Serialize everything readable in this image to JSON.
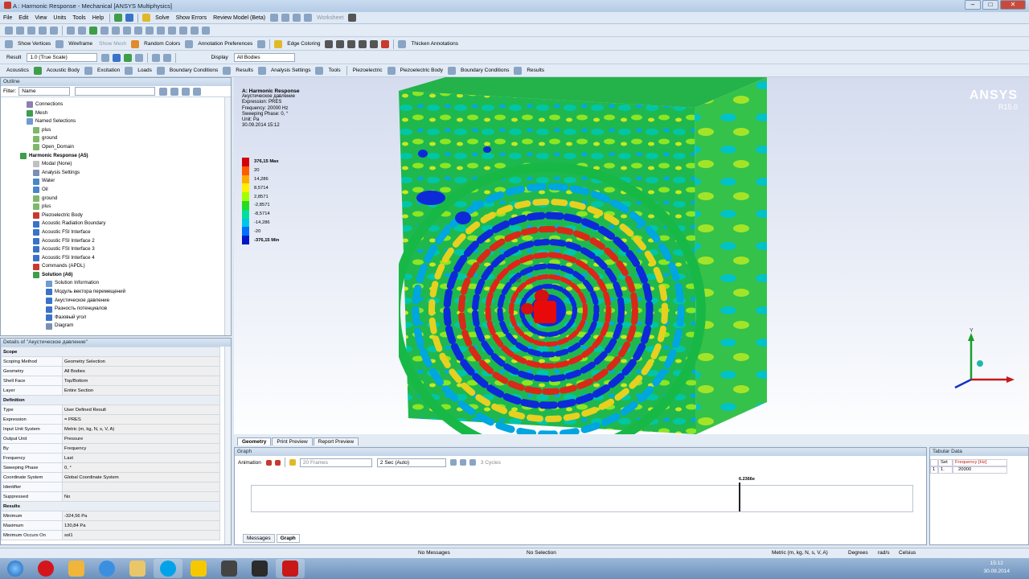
{
  "window": {
    "title": "A : Harmonic Response - Mechanical [ANSYS Multiphysics]"
  },
  "menu": {
    "items": [
      "File",
      "Edit",
      "View",
      "Units",
      "Tools",
      "Help"
    ],
    "solve": "Solve",
    "show_errors": "Show Errors",
    "review_model": "Review Model (Beta)",
    "worksheet": "Worksheet"
  },
  "toolbar2": {
    "show_vertices": "Show Vertices",
    "wireframe": "Wireframe",
    "show_mesh": "Show Mesh",
    "random_colors": "Random Colors",
    "annotation_prefs": "Annotation Preferences",
    "edge_coloring": "Edge Coloring",
    "thicken": "Thicken Annotations"
  },
  "toolbar3": {
    "result_label": "Result",
    "scale": "1.0 (True Scale)",
    "display_label": "Display",
    "display_value": "All Bodies"
  },
  "toolbar4": {
    "items": [
      "Acoustics",
      "Acoustic Body",
      "Excitation",
      "Loads",
      "Boundary Conditions",
      "Results",
      "Analysis Settings",
      "Tools",
      "Piezoelectric",
      "Piezoelectric Body",
      "Boundary Conditions",
      "Results"
    ]
  },
  "outline": {
    "title": "Outline",
    "filter_label": "Filter:",
    "filter_value": "Name",
    "items": [
      {
        "label": "Connections",
        "color": "#8a7fb3"
      },
      {
        "label": "Mesh",
        "color": "#3f9d4c"
      },
      {
        "label": "Named Selections",
        "color": "#6e9bd1"
      },
      {
        "label": "plus",
        "color": "#7fb86b"
      },
      {
        "label": "ground",
        "color": "#7fb86b"
      },
      {
        "label": "Open_Domain",
        "color": "#7fb86b"
      },
      {
        "label": "Harmonic Response (A5)",
        "color": "#3f9d4c"
      },
      {
        "label": "Modal (None)",
        "color": "#c0c0c0"
      },
      {
        "label": "Analysis Settings",
        "color": "#7a8fb3"
      },
      {
        "label": "Water",
        "color": "#4a86c8"
      },
      {
        "label": "Oil",
        "color": "#4a86c8"
      },
      {
        "label": "ground",
        "color": "#7fb86b"
      },
      {
        "label": "plus",
        "color": "#7fb86b"
      },
      {
        "label": "Piezoelectric Body",
        "color": "#c83a2e"
      },
      {
        "label": "Acoustic Radiation Boundary",
        "color": "#3a72c8"
      },
      {
        "label": "Acoustic FSI Interface",
        "color": "#3a72c8"
      },
      {
        "label": "Acoustic FSI Interface 2",
        "color": "#3a72c8"
      },
      {
        "label": "Acoustic FSI Interface 3",
        "color": "#3a72c8"
      },
      {
        "label": "Acoustic FSI Interface 4",
        "color": "#3a72c8"
      },
      {
        "label": "Commands (APDL)",
        "color": "#c83a2e"
      },
      {
        "label": "Solution (A6)",
        "color": "#3f9d4c"
      },
      {
        "label": "Solution Information",
        "color": "#6e9bd1"
      },
      {
        "label": "Модуль вектора перемещений",
        "color": "#3a72c8"
      },
      {
        "label": "Акустическое давление",
        "color": "#3a72c8"
      },
      {
        "label": "Разность потенциалов",
        "color": "#3a72c8"
      },
      {
        "label": "Фазовый угол",
        "color": "#3a72c8"
      },
      {
        "label": "Diagram",
        "color": "#7a8fb3"
      }
    ]
  },
  "details": {
    "title": "Details of \"Акустическое давление\"",
    "rows": [
      {
        "k": "Scope",
        "v": "",
        "sec": true
      },
      {
        "k": "Scoping Method",
        "v": "Geometry Selection"
      },
      {
        "k": "Geometry",
        "v": "All Bodies"
      },
      {
        "k": "Shell Face",
        "v": "Top/Bottom"
      },
      {
        "k": "Layer",
        "v": "Entire Section"
      },
      {
        "k": "Definition",
        "v": "",
        "sec": true
      },
      {
        "k": "Type",
        "v": "User Defined Result"
      },
      {
        "k": "Expression",
        "v": "= PRES"
      },
      {
        "k": "Input Unit System",
        "v": "Metric (m, kg, N, s, V, A)"
      },
      {
        "k": "Output Unit",
        "v": "Pressure"
      },
      {
        "k": "By",
        "v": "Frequency"
      },
      {
        "k": "Frequency",
        "v": "Last"
      },
      {
        "k": "Sweeping Phase",
        "v": "0, °"
      },
      {
        "k": "Coordinate System",
        "v": "Global Coordinate System"
      },
      {
        "k": "Identifier",
        "v": ""
      },
      {
        "k": "Suppressed",
        "v": "No"
      },
      {
        "k": "Results",
        "v": "",
        "sec": true
      },
      {
        "k": "Minimum",
        "v": "-324,56 Pa"
      },
      {
        "k": "Maximum",
        "v": "130,84 Pa"
      },
      {
        "k": "Minimum Occurs On",
        "v": "sol1"
      }
    ]
  },
  "viewport": {
    "header": [
      "A: Harmonic Response",
      "Акустическое давление",
      "Expression: PRES",
      "Frequency: 20000 Hz",
      "Sweeping Phase: 0, °",
      "Unit: Pa",
      "30.09.2014 15:12"
    ],
    "brand": "ANSYS",
    "version": "R15.0",
    "legend": [
      {
        "label": "376,15 Max",
        "color": "#d4000a",
        "bold": true
      },
      {
        "label": "20",
        "color": "#ff5a00"
      },
      {
        "label": "14,286",
        "color": "#ffaa00"
      },
      {
        "label": "8,5714",
        "color": "#fff000"
      },
      {
        "label": "2,8571",
        "color": "#a4ff00"
      },
      {
        "label": "-2,8571",
        "color": "#22dd22"
      },
      {
        "label": "-8,5714",
        "color": "#00e09a"
      },
      {
        "label": "-14,286",
        "color": "#00c6e6"
      },
      {
        "label": "-20",
        "color": "#0070ff"
      },
      {
        "label": "-376,15 Min",
        "color": "#0016c8",
        "bold": true
      }
    ]
  },
  "tabs": [
    "Geometry",
    "Print Preview",
    "Report Preview"
  ],
  "graph": {
    "title": "Graph",
    "animation": "Animation",
    "frames": "20 Frames",
    "duration": "2 Sec (Auto)",
    "cycles": "3 Cycles",
    "marker": "6.2366e"
  },
  "bottom_tabs": [
    "Messages",
    "Graph"
  ],
  "tabular": {
    "title": "Tabular Data",
    "col_set": "Set",
    "col_freq": "Frequency [Hz]",
    "row_idx": "1",
    "row_set": "1.",
    "row_val": "20000"
  },
  "status": {
    "messages": "No Messages",
    "selection": "No Selection",
    "units": "Metric (m, kg, N, s, V, A)",
    "deg": "Degrees",
    "rads": "rad/s",
    "cel": "Celsius"
  },
  "clock": {
    "time": "15:12",
    "date": "30.09.2014"
  }
}
